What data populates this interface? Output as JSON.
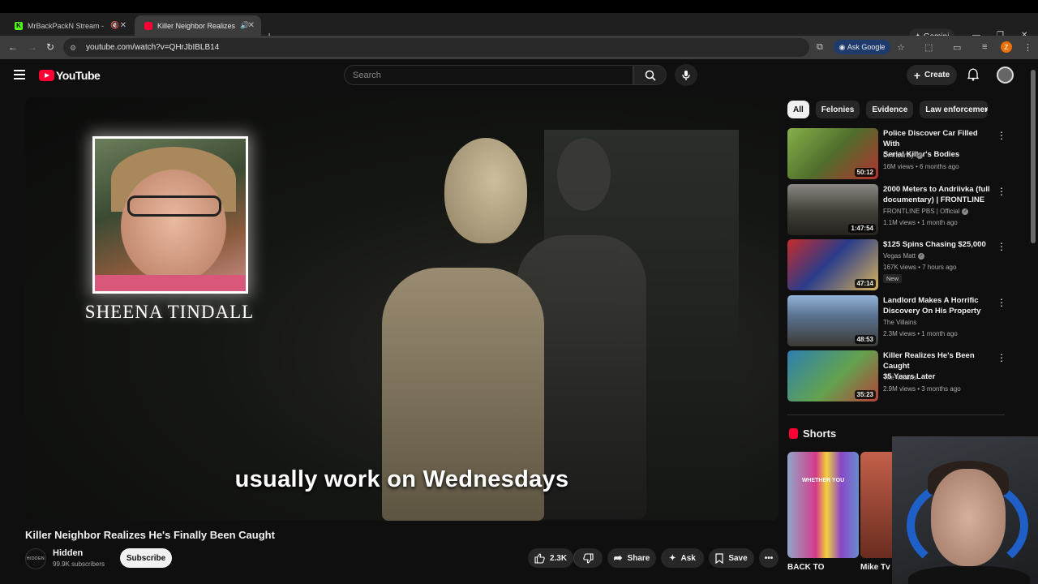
{
  "browser": {
    "tabs": [
      {
        "title": "MrBackPackN Stream - Wa",
        "favicon": "kick-icon"
      },
      {
        "title": "Killer Neighbor Realizes He",
        "favicon": "youtube-icon",
        "active": true
      }
    ],
    "gemini_label": "Gemini",
    "url": "youtube.com/watch?v=QHrJbIBLB14",
    "ask_google_label": "Ask Google",
    "profile_initial": "Z"
  },
  "youtube": {
    "logo_text": "YouTube",
    "search_placeholder": "Search",
    "create_label": "Create"
  },
  "video": {
    "overlay_name": "SHEENA TINDALL",
    "caption": "usually work on Wednesdays",
    "title": "Killer Neighbor Realizes He's Finally Been Caught",
    "channel": {
      "name": "Hidden",
      "avatar_text": "HIDDEN",
      "subscribers": "99.9K subscribers"
    },
    "subscribe_label": "Subscribe",
    "likes": "2.3K",
    "share_label": "Share",
    "ask_label": "Ask",
    "save_label": "Save"
  },
  "sidebar": {
    "chips": [
      "All",
      "Felonies",
      "Evidence",
      "Law enforcement"
    ],
    "recommendations": [
      {
        "title_l1": "Police Discover Car Filled With",
        "title_l2": "Serial Killer's Bodies",
        "channel": "Dr Insanity",
        "verified": true,
        "meta": "16M views • 6 months ago",
        "duration": "50:12",
        "thumb_color": "#6d8f3b"
      },
      {
        "title_l1": "2000 Meters to Andriivka (full",
        "title_l2": "documentary) | FRONTLINE",
        "channel": "FRONTLINE PBS | Official",
        "verified": true,
        "meta": "1.1M views • 1 month ago",
        "duration": "1:47:54",
        "thumb_color": "#55504a"
      },
      {
        "title_l1": "$125 Spins Chasing $25,000",
        "title_l2": "",
        "channel": "Vegas Matt",
        "verified": true,
        "meta": "167K views • 7 hours ago",
        "duration": "47:14",
        "badge": "New",
        "thumb_color": "#2b3c8a"
      },
      {
        "title_l1": "Landlord Makes A Horrific",
        "title_l2": "Discovery On His Property",
        "channel": "The Villains",
        "verified": false,
        "meta": "2.3M views • 1 month ago",
        "duration": "48:53",
        "thumb_color": "#5a7290"
      },
      {
        "title_l1": "Killer Realizes He's Been Caught",
        "title_l2": "35 Years Later",
        "channel": "The Villains",
        "verified": false,
        "meta": "2.9M views • 3 months ago",
        "duration": "35:23",
        "thumb_color": "#2d7fb0"
      }
    ],
    "shorts_title": "Shorts",
    "shorts": [
      {
        "overlay": "WHETHER YOU",
        "label": "BACK TO"
      },
      {
        "overlay": "",
        "label": "Mike Tv"
      }
    ]
  }
}
